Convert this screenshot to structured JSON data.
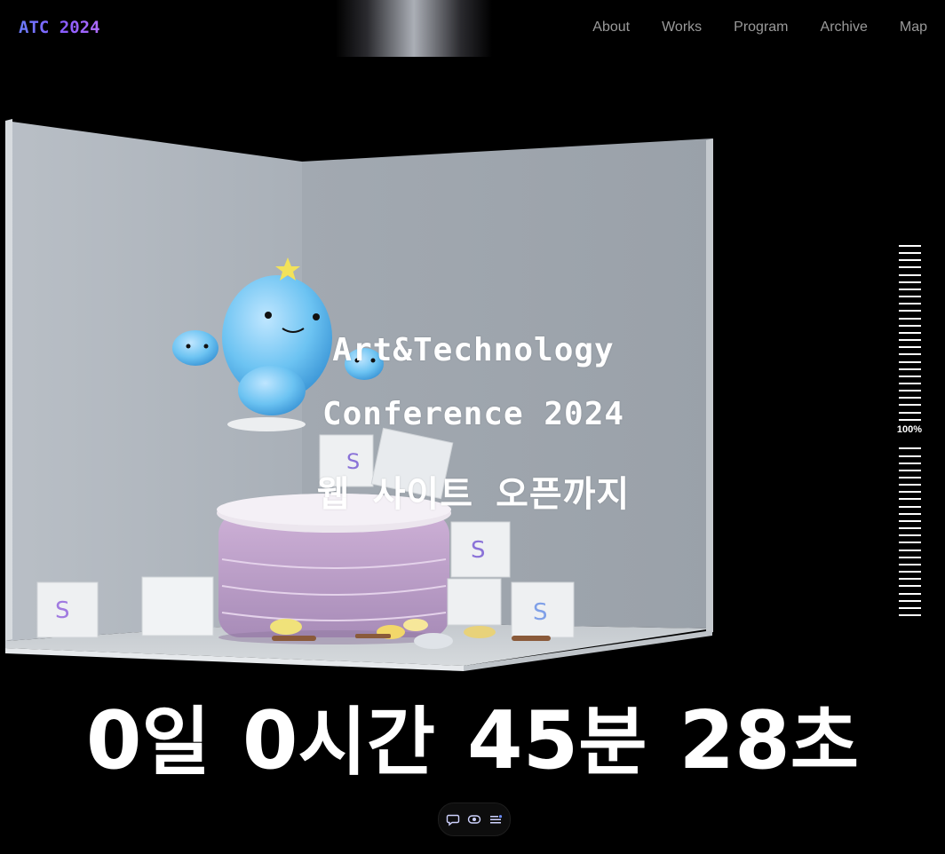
{
  "header": {
    "logo": "ATC 2024",
    "nav": [
      {
        "label": "About"
      },
      {
        "label": "Works"
      },
      {
        "label": "Program"
      },
      {
        "label": "Archive"
      },
      {
        "label": "Map"
      }
    ]
  },
  "hero": {
    "line1": "Art&Technology",
    "line2": "Conference 2024",
    "line3": "웹 사이트 오픈까지"
  },
  "progress": {
    "label": "100%",
    "value": 1.0
  },
  "countdown": {
    "days": "0",
    "days_unit": "일",
    "hours": "0",
    "hours_unit": "시간",
    "minutes": "45",
    "minutes_unit": "분",
    "seconds": "28",
    "seconds_unit": "초"
  },
  "toolbar": {
    "icons": [
      "comment-icon",
      "eye-icon",
      "menu-list-icon"
    ]
  },
  "colors": {
    "background": "#000000",
    "logo_gradient_start": "#6a7cff",
    "logo_gradient_end": "#b06cff",
    "nav_text": "#9a9a9a",
    "text": "#ffffff"
  }
}
